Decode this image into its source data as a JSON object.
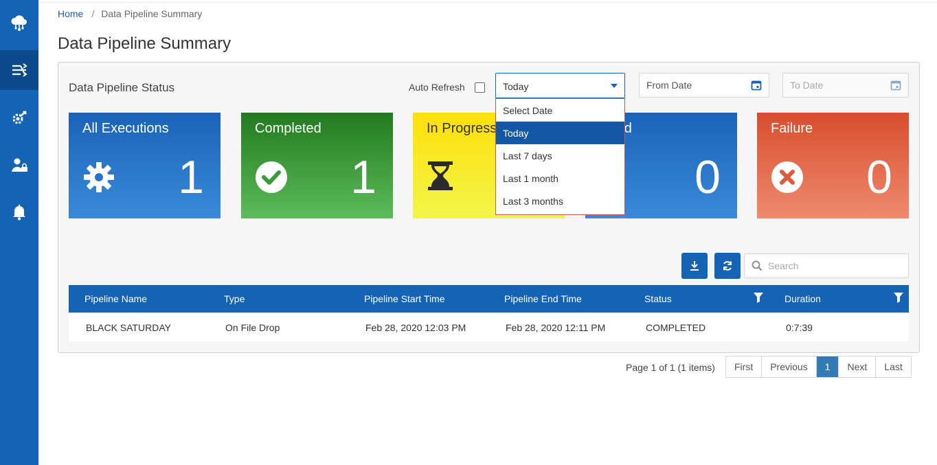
{
  "sidebar": {
    "items": [
      {
        "icon": "cloud-network-icon"
      },
      {
        "icon": "pipeline-icon",
        "active": true
      },
      {
        "icon": "settings-tools-icon"
      },
      {
        "icon": "user-lock-icon"
      },
      {
        "icon": "bell-icon"
      }
    ]
  },
  "breadcrumb": {
    "home": "Home",
    "separator": "/",
    "current": "Data Pipeline Summary"
  },
  "page_title": "Data Pipeline Summary",
  "panel": {
    "title": "Data Pipeline Status",
    "auto_refresh_label": "Auto Refresh",
    "auto_refresh_checked": false,
    "range_select": {
      "value": "Today"
    },
    "from_date_placeholder": "From Date",
    "to_date_placeholder": "To Date"
  },
  "dropdown": {
    "options": [
      "Select Date",
      "Today",
      "Last 7 days",
      "Last 1 month",
      "Last 3 months"
    ],
    "selected": "Today"
  },
  "cards": [
    {
      "label": "All Executions",
      "value": "1",
      "icon": "gear-icon",
      "color": "#1a62b8"
    },
    {
      "label": "Completed",
      "value": "1",
      "icon": "check-circle-icon",
      "color": "#23791f"
    },
    {
      "label": "In Progress",
      "value": "",
      "icon": "hourglass-icon",
      "color": "#ffe00a"
    },
    {
      "label": "eived",
      "value": "0",
      "icon": "pencil-icon",
      "color": "#1a62b8"
    },
    {
      "label": "Failure",
      "value": "0",
      "icon": "x-circle-icon",
      "color": "#d84d2e"
    }
  ],
  "toolbar": {
    "search_placeholder": "Search"
  },
  "table": {
    "columns": [
      "Pipeline Name",
      "Type",
      "Pipeline Start Time",
      "Pipeline End Time",
      "Status",
      "Duration"
    ],
    "rows": [
      [
        "BLACK SATURDAY",
        "On File Drop",
        "Feb 28, 2020 12:03 PM",
        "Feb 28, 2020 12:11 PM",
        "COMPLETED",
        "0:7:39"
      ]
    ]
  },
  "pager": {
    "info": "Page 1 of 1 (1 items)",
    "first": "First",
    "previous": "Previous",
    "current": "1",
    "next": "Next",
    "last": "Last"
  }
}
